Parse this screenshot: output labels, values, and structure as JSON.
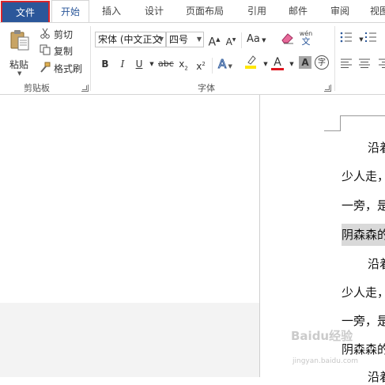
{
  "tabs": {
    "file": "文件",
    "home": "开始",
    "insert": "插入",
    "design": "设计",
    "layout": "页面布局",
    "references": "引用",
    "mailings": "邮件",
    "review": "审阅",
    "view": "视图"
  },
  "clipboard": {
    "paste": "粘贴",
    "cut": "剪切",
    "copy": "复制",
    "format_painter": "格式刷",
    "group_label": "剪贴板"
  },
  "font": {
    "font_name": "宋体 (中文正文",
    "font_size": "四号",
    "grow": "A",
    "shrink": "A",
    "case": "Aa",
    "phonetic_top": "wén",
    "phonetic_bottom": "文",
    "bold": "B",
    "italic": "I",
    "underline": "U",
    "strike": "abc",
    "subscript": "x",
    "superscript": "x",
    "sub_mark": "2",
    "sup_mark": "2",
    "text_effect": "A",
    "font_color": "A",
    "char_shading": "A",
    "enclosed": "字",
    "group_label": "字体"
  },
  "document": {
    "lines": [
      "沿着",
      "少人走，",
      "一旁，是",
      "阴森森的",
      "沿着",
      "少人走，",
      "一旁，是",
      "阴森森的",
      "沿着"
    ]
  },
  "watermark": {
    "main": "Baidu经验",
    "sub": "jingyan.baidu.com"
  },
  "colors": {
    "file_tab": "#2b579a",
    "highlight_box": "#d9262b",
    "highlight_yellow": "#ffe600",
    "font_red": "#e0141e"
  }
}
